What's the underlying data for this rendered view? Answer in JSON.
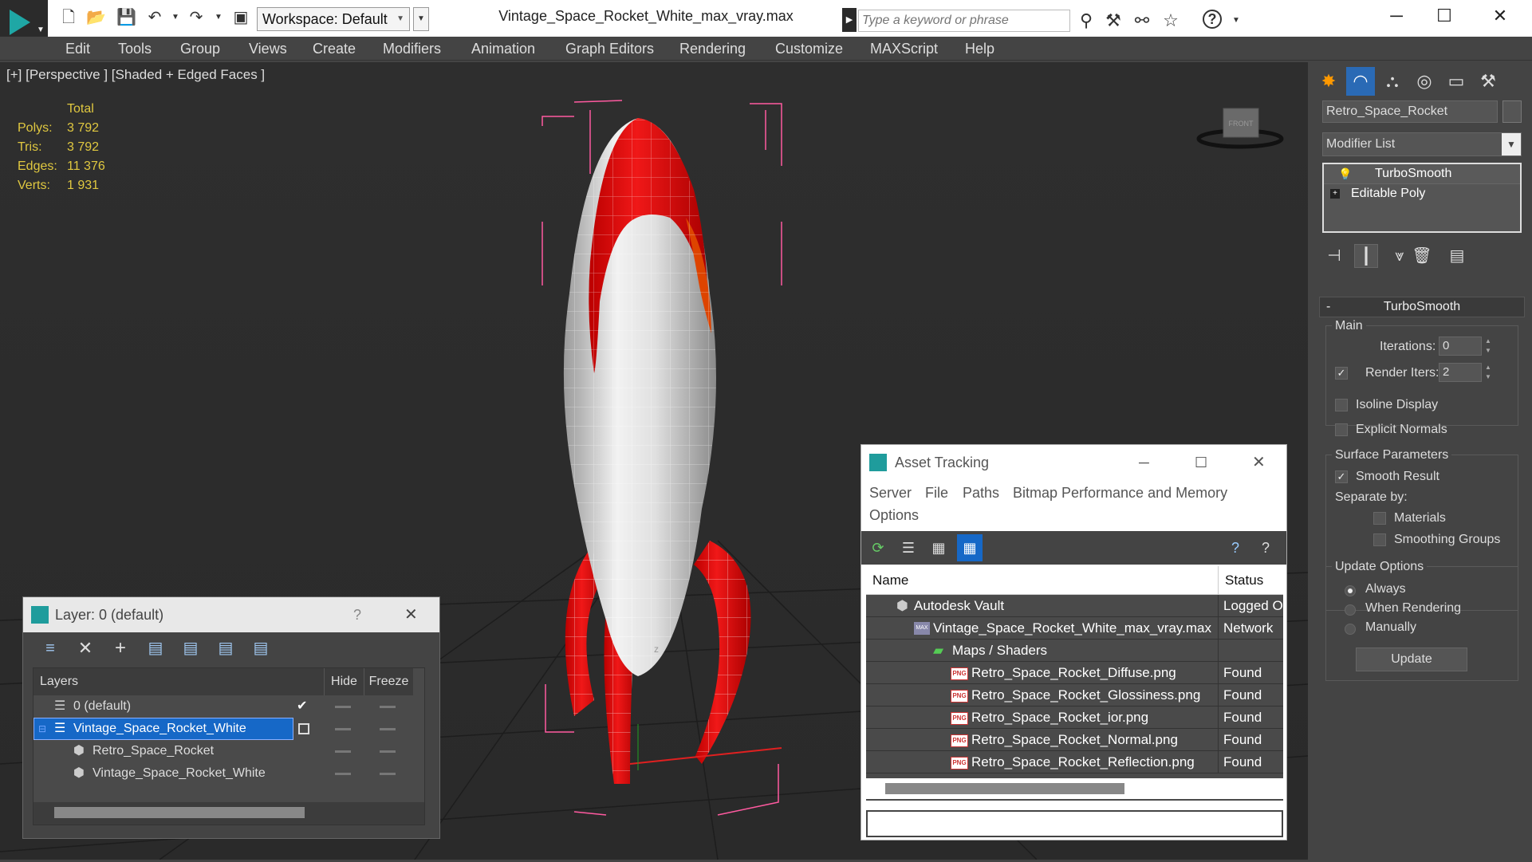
{
  "titlebar": {
    "workspace_label": "Workspace: Default",
    "window_title": "Vintage_Space_Rocket_White_max_vray.max",
    "search_placeholder": "Type a keyword or phrase"
  },
  "menu": {
    "items": [
      "Edit",
      "Tools",
      "Group",
      "Views",
      "Create",
      "Modifiers",
      "Animation",
      "Graph Editors",
      "Rendering",
      "Customize",
      "MAXScript",
      "Help"
    ]
  },
  "viewport": {
    "label": "[+] [Perspective ] [Shaded + Edged Faces ]",
    "viewcube_label": "FRONT",
    "stats": {
      "header": "Total",
      "polys_label": "Polys:",
      "polys_value": "3 792",
      "tris_label": "Tris:",
      "tris_value": "3 792",
      "edges_label": "Edges:",
      "edges_value": "11 376",
      "verts_label": "Verts:",
      "verts_value": "1 931"
    },
    "axis_label": "z"
  },
  "layer_dialog": {
    "title": "Layer: 0 (default)",
    "help": "?",
    "col_layers": "Layers",
    "col_hide": "Hide",
    "col_freeze": "Freeze",
    "rows": [
      {
        "label": "0 (default)"
      },
      {
        "label": "Vintage_Space_Rocket_White"
      },
      {
        "label": "Retro_Space_Rocket"
      },
      {
        "label": "Vintage_Space_Rocket_White"
      }
    ]
  },
  "asset_tracking": {
    "title": "Asset Tracking",
    "menu": [
      "Server",
      "File",
      "Paths",
      "Bitmap Performance and Memory",
      "Options"
    ],
    "col_name": "Name",
    "col_status": "Status",
    "rows": [
      {
        "name": "Autodesk Vault",
        "status": "Logged Out"
      },
      {
        "name": "Vintage_Space_Rocket_White_max_vray.max",
        "status": "Network"
      },
      {
        "name": "Maps / Shaders",
        "status": ""
      },
      {
        "name": "Retro_Space_Rocket_Diffuse.png",
        "status": "Found"
      },
      {
        "name": "Retro_Space_Rocket_Glossiness.png",
        "status": "Found"
      },
      {
        "name": "Retro_Space_Rocket_ior.png",
        "status": "Found"
      },
      {
        "name": "Retro_Space_Rocket_Normal.png",
        "status": "Found"
      },
      {
        "name": "Retro_Space_Rocket_Reflection.png",
        "status": "Found"
      }
    ],
    "png_badge": "PNG",
    "max_badge": "MAX"
  },
  "command_panel": {
    "object_name": "Retro_Space_Rocket",
    "modifier_list": "Modifier List",
    "stack": [
      "TurboSmooth",
      "Editable Poly"
    ],
    "rollout_title": "TurboSmooth",
    "rollout_collapse": "-",
    "main_label": "Main",
    "iterations_label": "Iterations:",
    "iterations_value": "0",
    "render_iters_label": "Render Iters:",
    "render_iters_value": "2",
    "isoline_label": "Isoline Display",
    "explicit_normals_label": "Explicit Normals",
    "surface_params_label": "Surface Parameters",
    "smooth_result_label": "Smooth Result",
    "separate_by_label": "Separate by:",
    "materials_label": "Materials",
    "smoothing_groups_label": "Smoothing Groups",
    "update_options_label": "Update Options",
    "always_label": "Always",
    "when_rendering_label": "When Rendering",
    "manually_label": "Manually",
    "update_button": "Update"
  },
  "colors": {
    "rocket_red": "#e8161b",
    "rocket_white": "#e6e6e6",
    "selection_blue": "#1668c7",
    "bbox_pink": "#ff5aa0",
    "stats_yellow": "#e0c840"
  }
}
